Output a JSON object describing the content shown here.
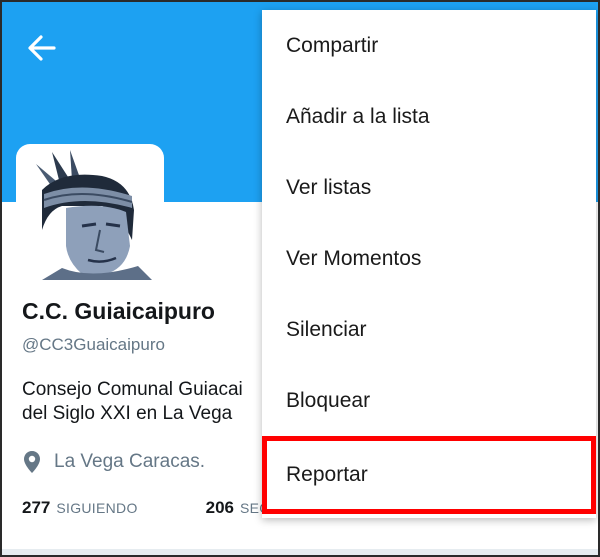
{
  "header": {
    "back_icon": "arrow-left-icon",
    "banner_color": "#1da1f2"
  },
  "profile": {
    "name": "C.C. Guiaicaipuro",
    "handle": "@CC3Guaicaipuro",
    "bio_line1": "Consejo Comunal Guiacai",
    "bio_line2": "del Siglo XXI en La Vega",
    "location_icon": "map-pin-icon",
    "location": "La Vega Caracas.",
    "following_count": "277",
    "following_label": "SIGUIENDO",
    "followers_count": "206",
    "followers_label": "SEGUIDORES"
  },
  "menu": {
    "items": [
      {
        "label": "Compartir"
      },
      {
        "label": "Añadir a la lista"
      },
      {
        "label": "Ver listas"
      },
      {
        "label": "Ver Momentos"
      },
      {
        "label": "Silenciar"
      },
      {
        "label": "Bloquear"
      },
      {
        "label": "Reportar"
      }
    ],
    "highlighted_index": 6,
    "highlight_color": "#ff0000"
  }
}
